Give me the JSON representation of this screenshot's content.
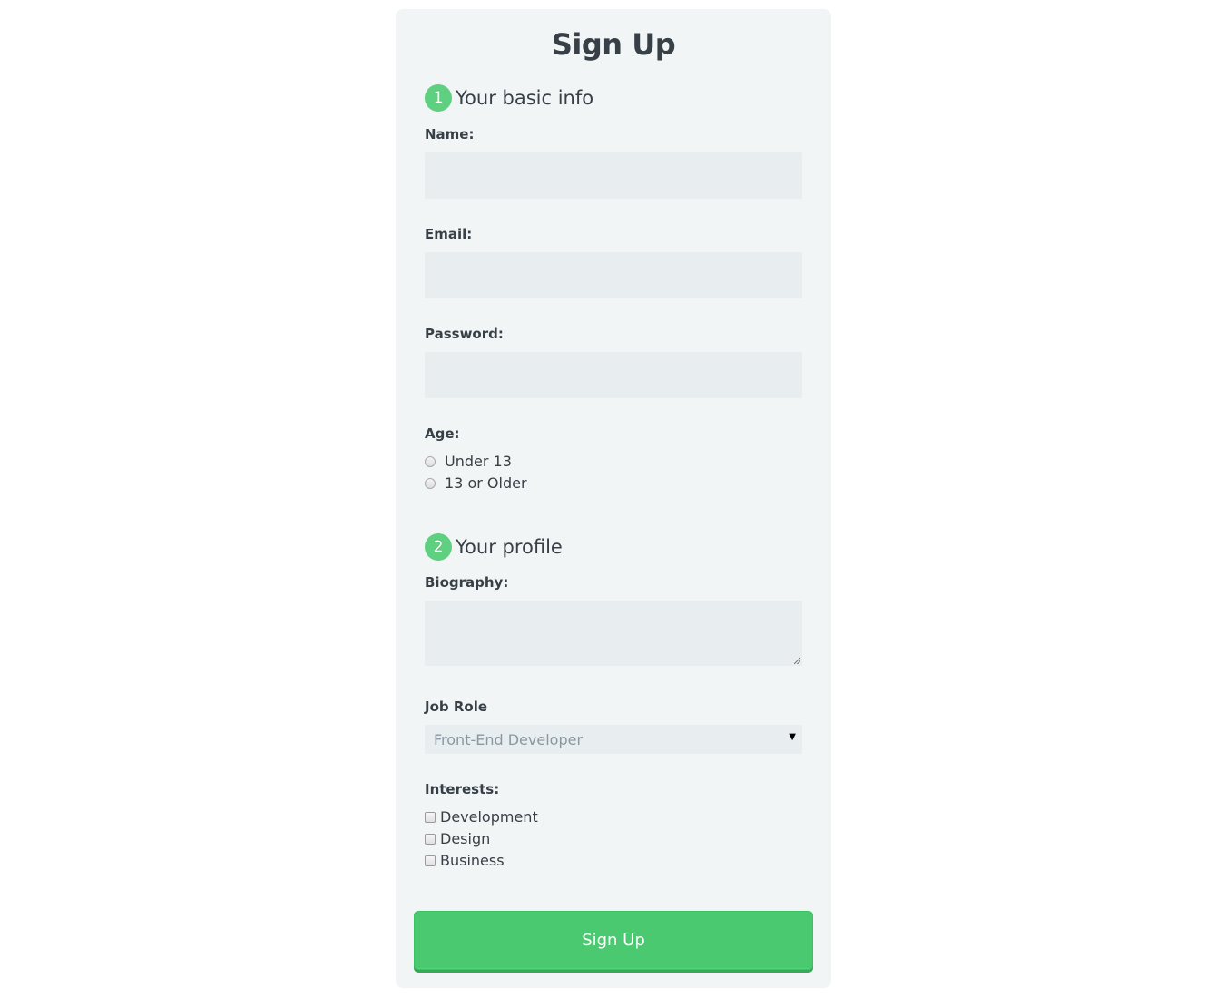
{
  "form": {
    "title": "Sign Up",
    "sections": [
      {
        "number": "1",
        "label": "Your basic info"
      },
      {
        "number": "2",
        "label": "Your profile"
      }
    ],
    "fields": {
      "name": {
        "label": "Name:",
        "value": ""
      },
      "email": {
        "label": "Email:",
        "value": ""
      },
      "password": {
        "label": "Password:",
        "value": ""
      },
      "biography": {
        "label": "Biography:",
        "value": ""
      }
    },
    "age": {
      "label": "Age:",
      "options": [
        "Under 13",
        "13 or Older"
      ]
    },
    "job_role": {
      "label": "Job Role",
      "selected": "Front-End Developer"
    },
    "interests": {
      "label": "Interests:",
      "options": [
        "Development",
        "Design",
        "Business"
      ]
    },
    "submit_label": "Sign Up"
  },
  "colors": {
    "accent_green": "#4bc970",
    "step_badge": "#5fcf80",
    "card_bg": "#f2f5f6",
    "field_bg": "#e8eeef",
    "text": "#384047"
  }
}
